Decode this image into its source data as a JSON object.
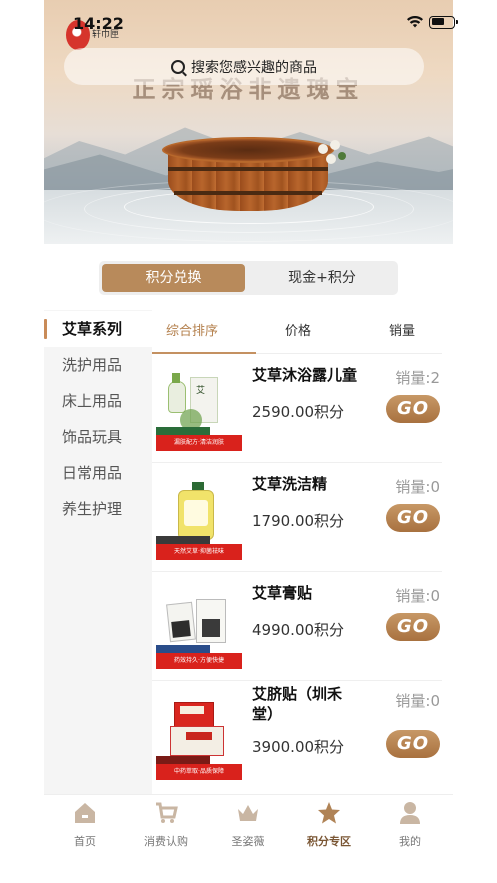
{
  "status_bar": {
    "time": "14:22"
  },
  "header": {
    "logo_text": "轩巾匣",
    "search_placeholder": "搜索您感兴趣的商品",
    "banner_title": "正宗瑶浴非遗瑰宝"
  },
  "toggle": {
    "options": [
      "积分兑换",
      "现金+积分"
    ],
    "selected": "积分兑换"
  },
  "categories": {
    "items": [
      "艾草系列",
      "洗护用品",
      "床上用品",
      "饰品玩具",
      "日常用品",
      "养生护理"
    ],
    "selected": "艾草系列"
  },
  "sort": {
    "columns": [
      "综合排序",
      "价格",
      "销量"
    ],
    "selected": "综合排序"
  },
  "products": [
    {
      "name": "艾草沐浴露儿童",
      "sales": "销量:2",
      "price": "2590.00积分",
      "image_caption": "漏肤配方·清洁润肤",
      "action": "GO"
    },
    {
      "name": "艾草洗洁精",
      "sales": "销量:0",
      "price": "1790.00积分",
      "image_caption": "天然艾草·抑菌祛味",
      "action": "GO"
    },
    {
      "name": "艾草膏贴",
      "sales": "销量:0",
      "price": "4990.00积分",
      "image_caption": "药效持久·方便快捷",
      "action": "GO"
    },
    {
      "name": "艾脐贴（圳禾堂）",
      "sales": "销量:0",
      "price": "3900.00积分",
      "image_caption": "中药萃取·品质保障",
      "action": "GO"
    }
  ],
  "tabbar": {
    "items": [
      {
        "label": "首页",
        "icon": "home-icon"
      },
      {
        "label": "消费认购",
        "icon": "cart-icon"
      },
      {
        "label": "圣姿薇",
        "icon": "crown-icon"
      },
      {
        "label": "积分专区",
        "icon": "star-icon"
      },
      {
        "label": "我的",
        "icon": "user-icon"
      }
    ],
    "selected": "积分专区"
  },
  "colors": {
    "accent": "#b88a5b",
    "go_button": "#a8713f",
    "active_text": "#b4804d"
  }
}
